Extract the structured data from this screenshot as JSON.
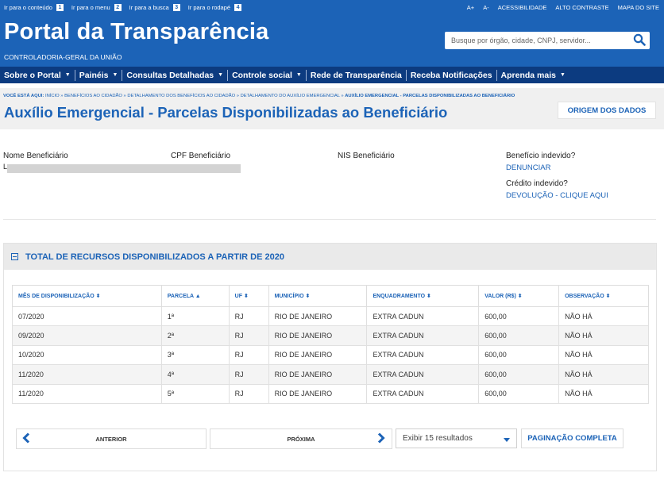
{
  "header": {
    "skip_links": [
      {
        "label": "Ir para o conteúdo",
        "key": "1"
      },
      {
        "label": "Ir para o menu",
        "key": "2"
      },
      {
        "label": "Ir para a busca",
        "key": "3"
      },
      {
        "label": "Ir para o rodapé",
        "key": "4"
      }
    ],
    "accessibility_links": [
      "A+",
      "A-",
      "ACESSIBILIDADE",
      "ALTO CONTRASTE",
      "MAPA DO SITE"
    ],
    "title": "Portal da Transparência",
    "subtitle": "CONTROLADORIA-GERAL DA UNIÃO",
    "search_placeholder": "Busque por órgão, cidade, CNPJ, servidor...",
    "search_icon": "search-icon"
  },
  "nav": {
    "items": [
      {
        "label": "Sobre o Portal",
        "has_dropdown": true
      },
      {
        "label": "Painéis",
        "has_dropdown": true
      },
      {
        "label": "Consultas Detalhadas",
        "has_dropdown": true
      },
      {
        "label": "Controle social",
        "has_dropdown": true
      },
      {
        "label": "Rede de Transparência",
        "has_dropdown": false
      },
      {
        "label": "Receba Notificações",
        "has_dropdown": false
      },
      {
        "label": "Aprenda mais",
        "has_dropdown": true
      }
    ]
  },
  "breadcrumb": {
    "prefix": "VOCÊ ESTÁ AQUI:",
    "items": [
      "INÍCIO",
      "BENEFÍCIOS AO CIDADÃO",
      "DETALHAMENTO DOS BENEFÍCIOS AO CIDADÃO",
      "DETALHAMENTO DO AUXÍLIO EMERGENCIAL"
    ],
    "separator": " » ",
    "current": "AUXÍLIO EMERGENCIAL - PARCELAS DISPONIBILIZADAS AO BENEFICIÁRIO"
  },
  "page": {
    "title": "Auxílio Emergencial - Parcelas Disponibilizadas ao Beneficiário",
    "origin_button": "ORIGEM DOS DADOS"
  },
  "beneficiary": {
    "name_label": "Nome Beneficiário",
    "name_value_initial": "L",
    "cpf_label": "CPF Beneficiário",
    "nis_label": "NIS Beneficiário",
    "undue_benefit_label": "Benefício indevido?",
    "undue_benefit_link": "DENUNCIAR",
    "undue_credit_label": "Crédito indevido?",
    "undue_credit_link": "DEVOLUÇÃO - CLIQUE AQUI"
  },
  "panel": {
    "title": "TOTAL DE RECURSOS DISPONIBILIZADOS A PARTIR DE 2020",
    "toggle_icon": "collapse-icon"
  },
  "table": {
    "columns": [
      {
        "label": "MÊS DE DISPONIBILIZAÇÃO",
        "sort": "both"
      },
      {
        "label": "PARCELA",
        "sort": "asc"
      },
      {
        "label": "UF",
        "sort": "both"
      },
      {
        "label": "MUNICÍPIO",
        "sort": "both"
      },
      {
        "label": "ENQUADRAMENTO",
        "sort": "both"
      },
      {
        "label": "VALOR (R$)",
        "sort": "both"
      },
      {
        "label": "OBSERVAÇÃO",
        "sort": "both"
      }
    ],
    "rows": [
      [
        "07/2020",
        "1ª",
        "RJ",
        "RIO DE JANEIRO",
        "EXTRA CADUN",
        "600,00",
        "NÃO HÁ"
      ],
      [
        "09/2020",
        "2ª",
        "RJ",
        "RIO DE JANEIRO",
        "EXTRA CADUN",
        "600,00",
        "NÃO HÁ"
      ],
      [
        "10/2020",
        "3ª",
        "RJ",
        "RIO DE JANEIRO",
        "EXTRA CADUN",
        "600,00",
        "NÃO HÁ"
      ],
      [
        "11/2020",
        "4ª",
        "RJ",
        "RIO DE JANEIRO",
        "EXTRA CADUN",
        "600,00",
        "NÃO HÁ"
      ],
      [
        "11/2020",
        "5ª",
        "RJ",
        "RIO DE JANEIRO",
        "EXTRA CADUN",
        "600,00",
        "NÃO HÁ"
      ]
    ]
  },
  "pagination": {
    "previous_label": "ANTERIOR",
    "next_label": "PRÓXIMA",
    "page_size_label": "Exibir 15 resultados",
    "full_pagination_label": "PAGINAÇÃO COMPLETA"
  },
  "colors": {
    "brand_blue": "#1c63b7",
    "nav_dark_blue": "#0c3b80",
    "band_gray": "#f0f0f0",
    "redaction_gray": "#d3d3d3"
  }
}
